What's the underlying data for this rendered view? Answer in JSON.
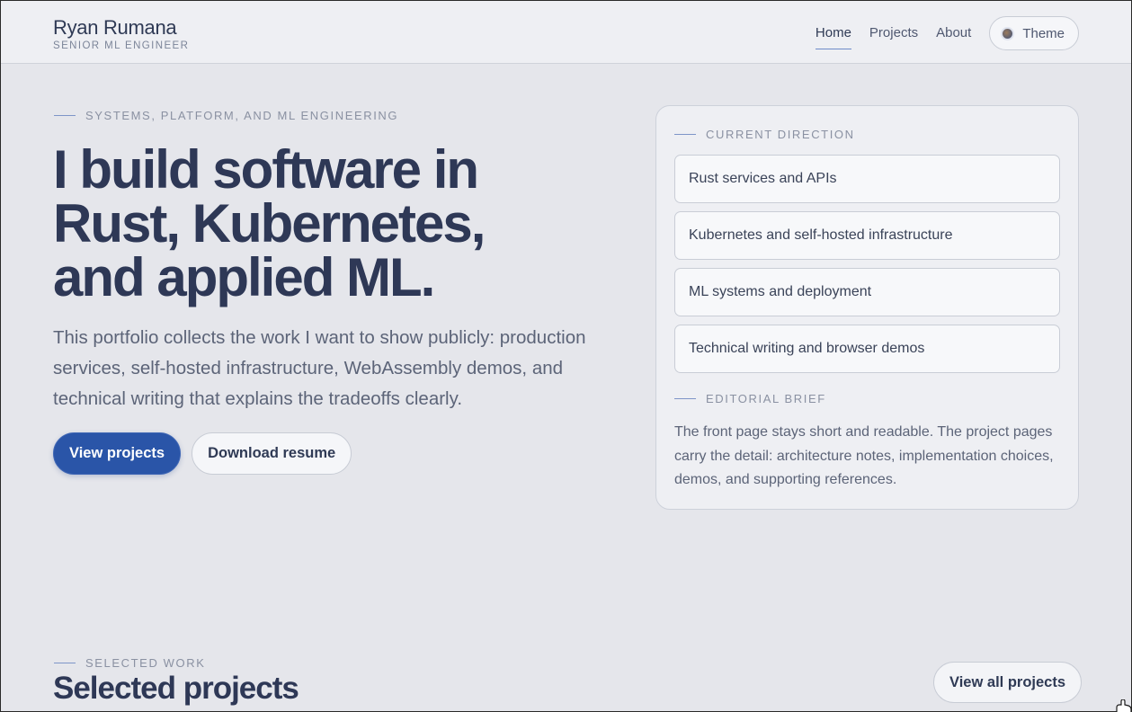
{
  "header": {
    "brand_name": "Ryan Rumana",
    "brand_subtitle": "SENIOR ML ENGINEER",
    "nav": [
      {
        "label": "Home",
        "active": true
      },
      {
        "label": "Projects",
        "active": false
      },
      {
        "label": "About",
        "active": false
      }
    ],
    "theme_label": "Theme",
    "theme_icon": "theme-dot-icon"
  },
  "hero": {
    "eyebrow": "SYSTEMS, PLATFORM, AND ML ENGINEERING",
    "title_lines": [
      "I build software in",
      "Rust, Kubernetes,",
      "and applied ML."
    ],
    "description": "This portfolio collects the work I want to show publicly: production services, self-hosted infrastructure, WebAssembly demos, and technical writing that explains the tradeoffs clearly.",
    "primary_button": "View projects",
    "secondary_button": "Download resume"
  },
  "panel": {
    "direction_eyebrow": "CURRENT DIRECTION",
    "directions": [
      "Rust services and APIs",
      "Kubernetes and self-hosted infrastructure",
      "ML systems and deployment",
      "Technical writing and browser demos"
    ],
    "brief_eyebrow": "EDITORIAL BRIEF",
    "brief_text": "The front page stays short and readable. The project pages carry the detail: architecture notes, implementation choices, demos, and supporting references."
  },
  "selected": {
    "eyebrow": "SELECTED WORK",
    "title": "Selected projects",
    "view_all": "View all projects"
  },
  "colors": {
    "accent": "#2a55a8",
    "background": "#e5e6eb",
    "text": "#2e3856"
  }
}
